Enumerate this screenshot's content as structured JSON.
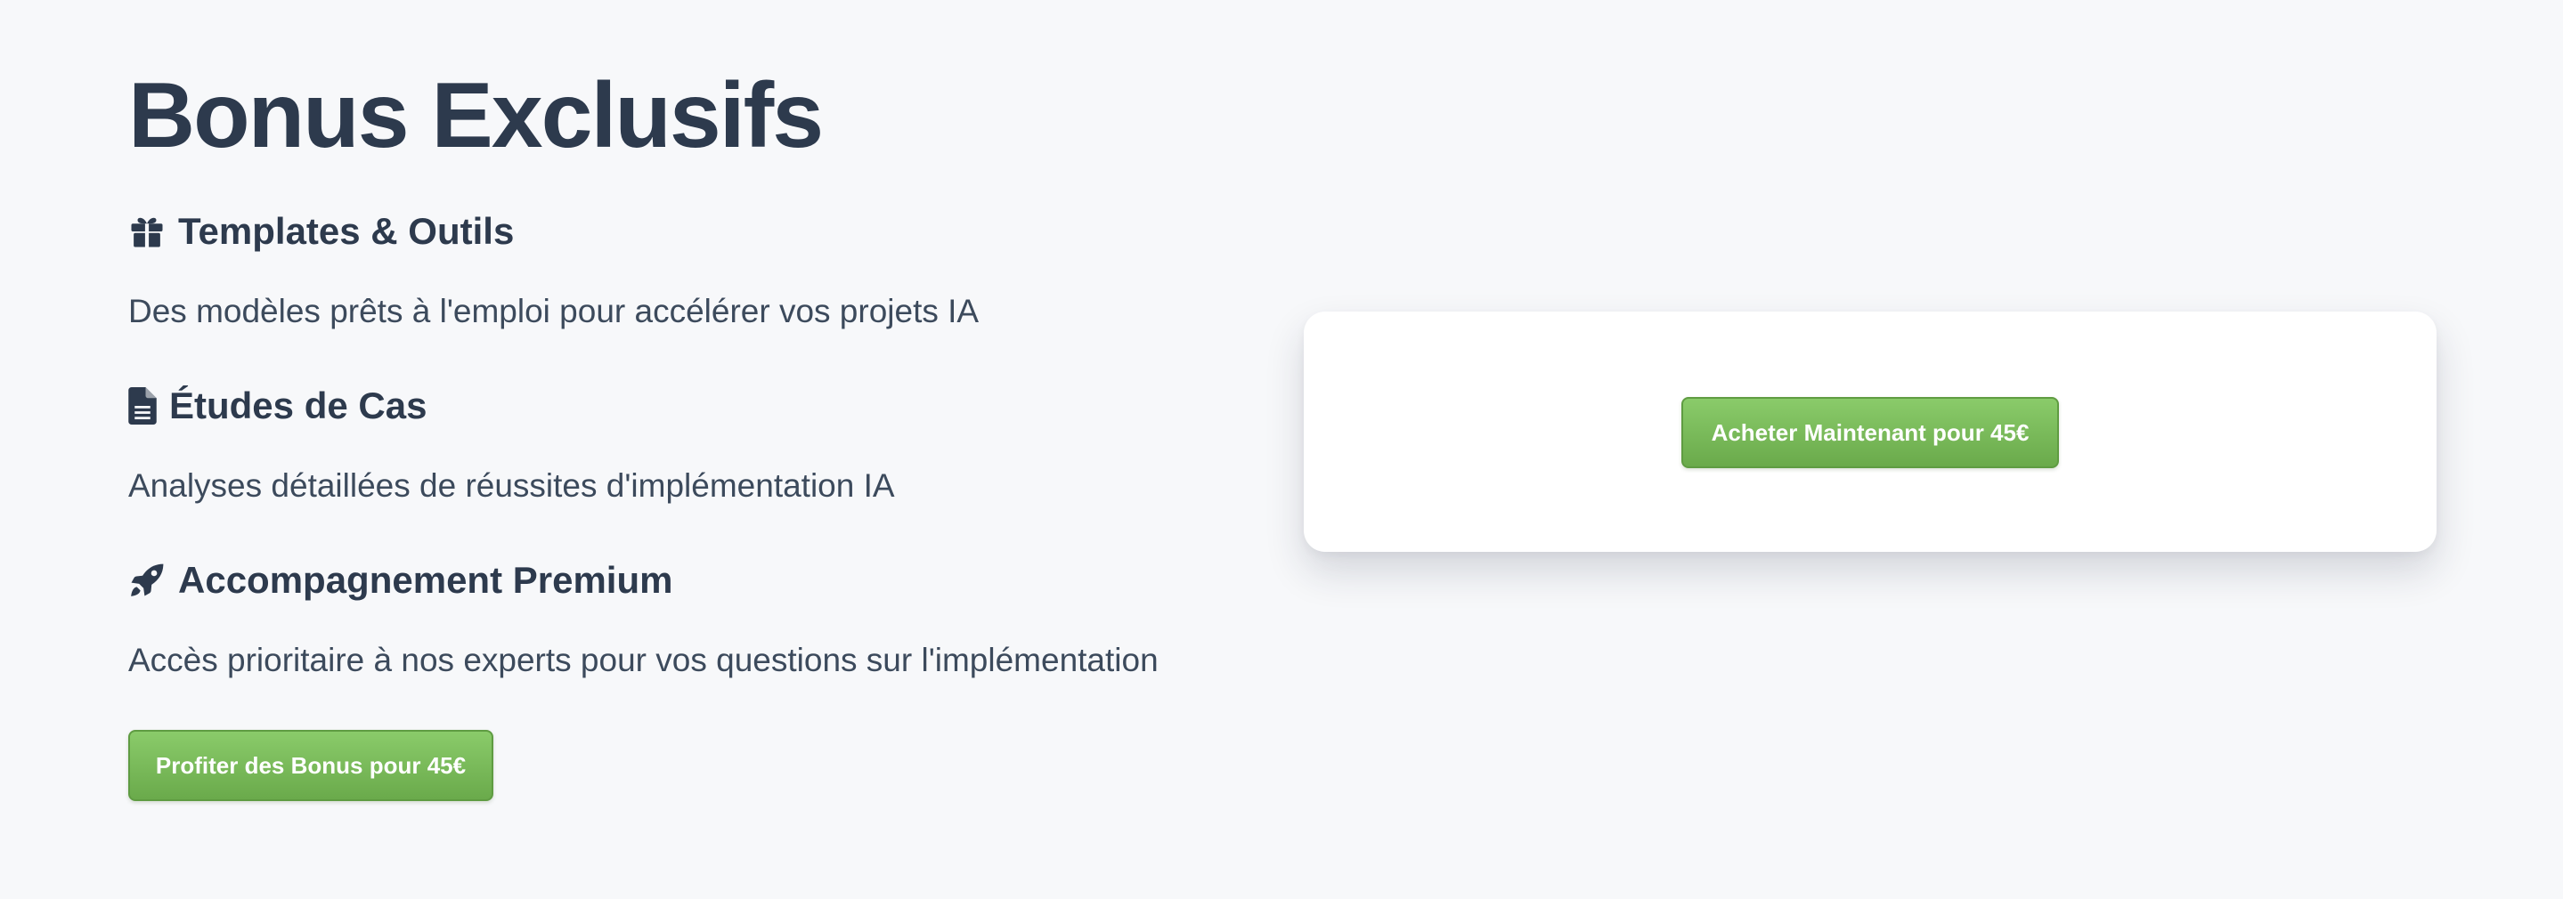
{
  "bonus_section": {
    "title": "Bonus Exclusifs",
    "items": [
      {
        "icon": "gift-icon",
        "heading": "Templates & Outils",
        "description": "Des modèles prêts à l'emploi pour accélérer vos projets IA"
      },
      {
        "icon": "file-document-icon",
        "heading": "Études de Cas",
        "description": "Analyses détaillées de réussites d'implémentation IA"
      },
      {
        "icon": "rocket-icon",
        "heading": "Accompagnement Premium",
        "description": "Accès prioritaire à nos experts pour vos questions sur l'implémentation"
      }
    ],
    "cta_label": "Profiter des Bonus pour 45€"
  },
  "purchase_card": {
    "cta_label": "Acheter Maintenant pour 45€"
  },
  "colors": {
    "background": "#f7f8fa",
    "text": "#2d3a4d",
    "button_green": "#78b957",
    "card": "#ffffff"
  }
}
